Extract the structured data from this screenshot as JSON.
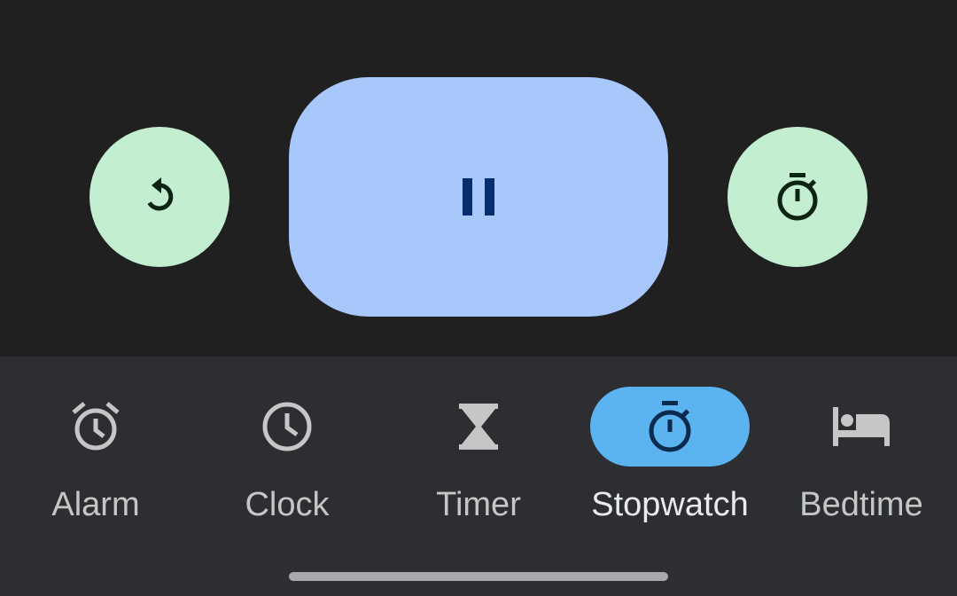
{
  "controls": {
    "reset_icon": "reset-icon",
    "pause_icon": "pause-icon",
    "lap_icon": "stopwatch-lap-icon"
  },
  "colors": {
    "background": "#202020",
    "secondary_button": "#c4eed0",
    "primary_button": "#a8c7fa",
    "nav_background": "#2d2e31",
    "nav_active_pill": "#5bb3f0"
  },
  "nav": {
    "items": [
      {
        "label": "Alarm",
        "icon": "alarm-icon",
        "active": false
      },
      {
        "label": "Clock",
        "icon": "clock-icon",
        "active": false
      },
      {
        "label": "Timer",
        "icon": "hourglass-icon",
        "active": false
      },
      {
        "label": "Stopwatch",
        "icon": "stopwatch-icon",
        "active": true
      },
      {
        "label": "Bedtime",
        "icon": "bed-icon",
        "active": false
      }
    ]
  }
}
